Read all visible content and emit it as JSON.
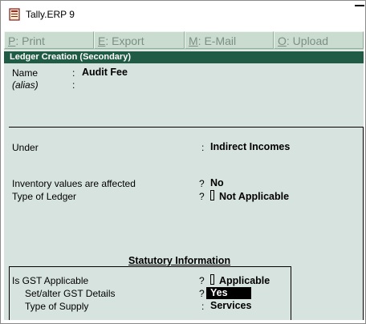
{
  "window": {
    "title": "Tally.ERP 9"
  },
  "toolbar": {
    "buttons": [
      {
        "key": "P",
        "label": ": Print"
      },
      {
        "key": "E",
        "label": ": Export"
      },
      {
        "key": "M",
        "label": ": E-Mail"
      },
      {
        "key": "O",
        "label": ": Upload"
      }
    ]
  },
  "screen": {
    "title": "Ledger Creation (Secondary)"
  },
  "form": {
    "name_label": "Name",
    "name_colon": ":",
    "name_value": "Audit Fee",
    "alias_label": "(alias)",
    "alias_colon": ":",
    "under_label": "Under",
    "under_colon": ":",
    "under_value": "Indirect Incomes",
    "inventory_label": "Inventory values are affected",
    "inventory_q": "?",
    "inventory_value": "No",
    "ledger_type_label": "Type of Ledger",
    "ledger_type_q": "?",
    "ledger_type_value": "Not Applicable"
  },
  "statutory": {
    "title": "Statutory Information",
    "gst_label": "Is GST Applicable",
    "gst_q": "?",
    "gst_value": "Applicable",
    "gst_details_label": "Set/alter GST Details",
    "gst_details_q": "?",
    "gst_details_value": "Yes",
    "supply_label": "Type of Supply",
    "supply_colon": ":",
    "supply_value": "Services"
  }
}
